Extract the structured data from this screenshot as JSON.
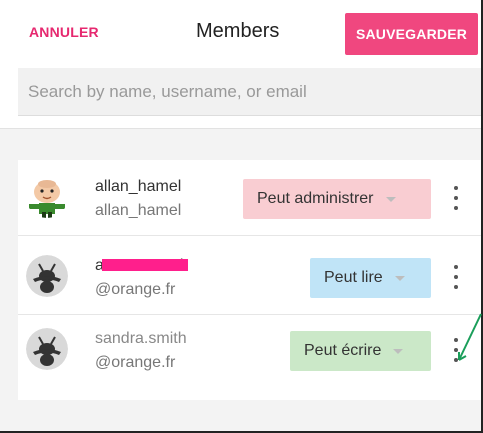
{
  "header": {
    "cancel_label": "ANNULER",
    "title": "Members",
    "save_label": "SAUVEGARDER"
  },
  "search": {
    "placeholder": "Search by name, username, or email"
  },
  "members": [
    {
      "name": "allan_hamel",
      "subtitle": "allan_hamel",
      "role": "Peut administrer",
      "role_color": "#f9cdd2",
      "avatar": "cartoon-character-avatar"
    },
    {
      "name": "a",
      "name_suffix": "l",
      "subtitle": "@orange.fr",
      "role": "Peut lire",
      "role_color": "#c0e4f7",
      "avatar": "ant-avatar",
      "name_redacted": true
    },
    {
      "name": "sandra.smith",
      "subtitle": "@orange.fr",
      "role": "Peut écrire",
      "role_color": "#cbe8c8",
      "avatar": "ant-avatar"
    }
  ],
  "colors": {
    "accent": "#e6286f",
    "save_bg": "#f0477f",
    "annotation_arrow": "#1a9e5a"
  }
}
